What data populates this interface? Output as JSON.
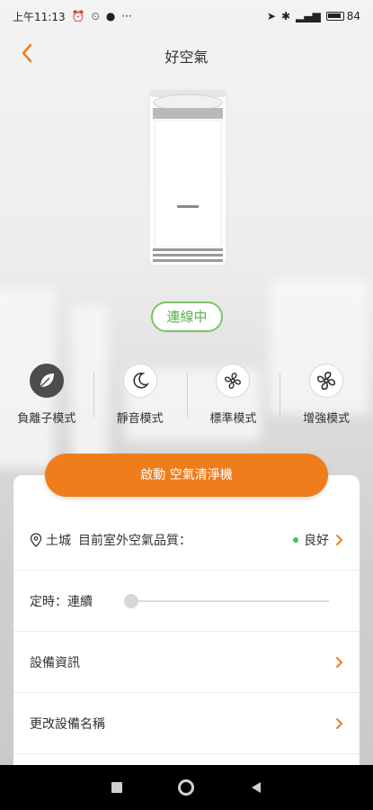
{
  "status_bar": {
    "time": "上午11:13",
    "battery": "84"
  },
  "header": {
    "title": "好空氣"
  },
  "device": {
    "connection_status": "連線中"
  },
  "modes": [
    {
      "label": "負離子模式",
      "icon": "leaf-icon",
      "active": true
    },
    {
      "label": "靜音模式",
      "icon": "moon-icon",
      "active": false
    },
    {
      "label": "標準模式",
      "icon": "fan-icon",
      "active": false
    },
    {
      "label": "增強模式",
      "icon": "fan-strong-icon",
      "active": false
    }
  ],
  "start_button": "啟動 空氣清淨機",
  "air_quality": {
    "location": "土城",
    "label": "目前室外空氣品質：",
    "value": "良好",
    "status_color": "#4cc24c"
  },
  "timer": {
    "label": "定時：連續",
    "slider_value": 0
  },
  "device_info": "設備資訊",
  "rename_device": "更改設備名稱",
  "colors": {
    "accent": "#f07d1b",
    "connected": "#59b34a"
  }
}
